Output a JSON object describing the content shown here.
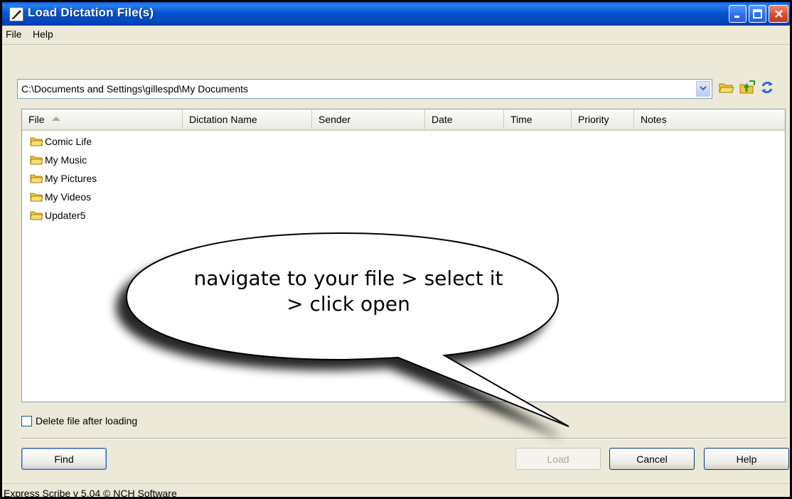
{
  "window": {
    "title": "Load Dictation File(s)",
    "controls": [
      "minimize",
      "maximize",
      "close"
    ],
    "colors": {
      "titlebar": "#0054e3",
      "close": "#d8482a",
      "face": "#ece9d8"
    }
  },
  "menu": {
    "items": [
      "File",
      "Help"
    ]
  },
  "path": {
    "value": "C:\\Documents and Settings\\gillespd\\My Documents",
    "tools": [
      "folder-open-icon",
      "folder-up-icon",
      "refresh-icon"
    ]
  },
  "columns": [
    "File",
    "Dictation Name",
    "Sender",
    "Date",
    "Time",
    "Priority",
    "Notes"
  ],
  "sort": {
    "column": "File",
    "direction": "ascending"
  },
  "files": [
    {
      "name": "Comic Life",
      "icon": "folder-icon"
    },
    {
      "name": "My Music",
      "icon": "folder-icon"
    },
    {
      "name": "My Pictures",
      "icon": "folder-icon"
    },
    {
      "name": "My Videos",
      "icon": "folder-icon"
    },
    {
      "name": "Updater5",
      "icon": "folder-icon"
    }
  ],
  "options": {
    "delete_after_loading": {
      "label": "Delete file after loading",
      "checked": false
    }
  },
  "buttons": {
    "find": "Find",
    "load": "Load",
    "cancel": "Cancel",
    "help": "Help"
  },
  "status": {
    "text": "Express Scribe v 5.04 © NCH Software"
  },
  "callout": {
    "line1": "navigate to your file > select it",
    "line2": "> click open"
  }
}
